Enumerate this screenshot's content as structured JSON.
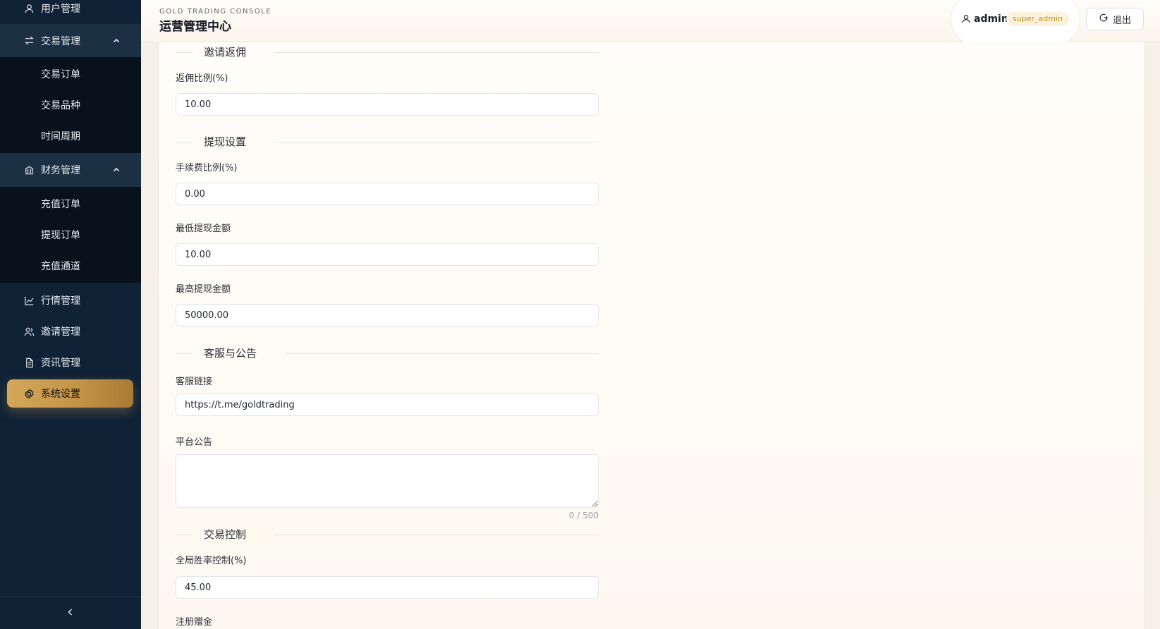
{
  "header": {
    "brand_sub": "GOLD TRADING CONSOLE",
    "brand_title": "运营管理中心",
    "user_name": "admin",
    "user_role": "super_admin",
    "logout_label": "退出"
  },
  "sidebar": {
    "items": [
      {
        "label": "用户管理",
        "icon": "user-icon"
      },
      {
        "label": "交易管理",
        "icon": "swap-icon",
        "expanded": true
      },
      {
        "label": "交易订单"
      },
      {
        "label": "交易品种"
      },
      {
        "label": "时间周期"
      },
      {
        "label": "财务管理",
        "icon": "bank-icon",
        "expanded": true
      },
      {
        "label": "充值订单"
      },
      {
        "label": "提现订单"
      },
      {
        "label": "充值通道"
      },
      {
        "label": "行情管理",
        "icon": "chart-line-icon"
      },
      {
        "label": "邀请管理",
        "icon": "users-icon"
      },
      {
        "label": "资讯管理",
        "icon": "document-icon"
      },
      {
        "label": "系统设置",
        "icon": "gear-icon",
        "active": true
      }
    ],
    "collapse_icon": "chevron-left-icon",
    "accent_color": "#c89a4c"
  },
  "form": {
    "sections": {
      "invite": "邀请返佣",
      "withdraw": "提现设置",
      "service": "客服与公告",
      "trade": "交易控制"
    },
    "fields": {
      "commission_rate": {
        "label": "返佣比例(%)",
        "value": "10.00"
      },
      "fee_rate": {
        "label": "手续费比例(%)",
        "value": "0.00"
      },
      "min_withdraw": {
        "label": "最低提现金额",
        "value": "10.00"
      },
      "max_withdraw": {
        "label": "最高提现金额",
        "value": "50000.00"
      },
      "service_link": {
        "label": "客服链接",
        "value": "https://t.me/goldtrading"
      },
      "announcement": {
        "label": "平台公告",
        "value": "",
        "counter": "0 / 500"
      },
      "win_rate": {
        "label": "全局胜率控制(%)",
        "value": "45.00"
      },
      "register_bonus": {
        "label": "注册赠金"
      }
    }
  }
}
